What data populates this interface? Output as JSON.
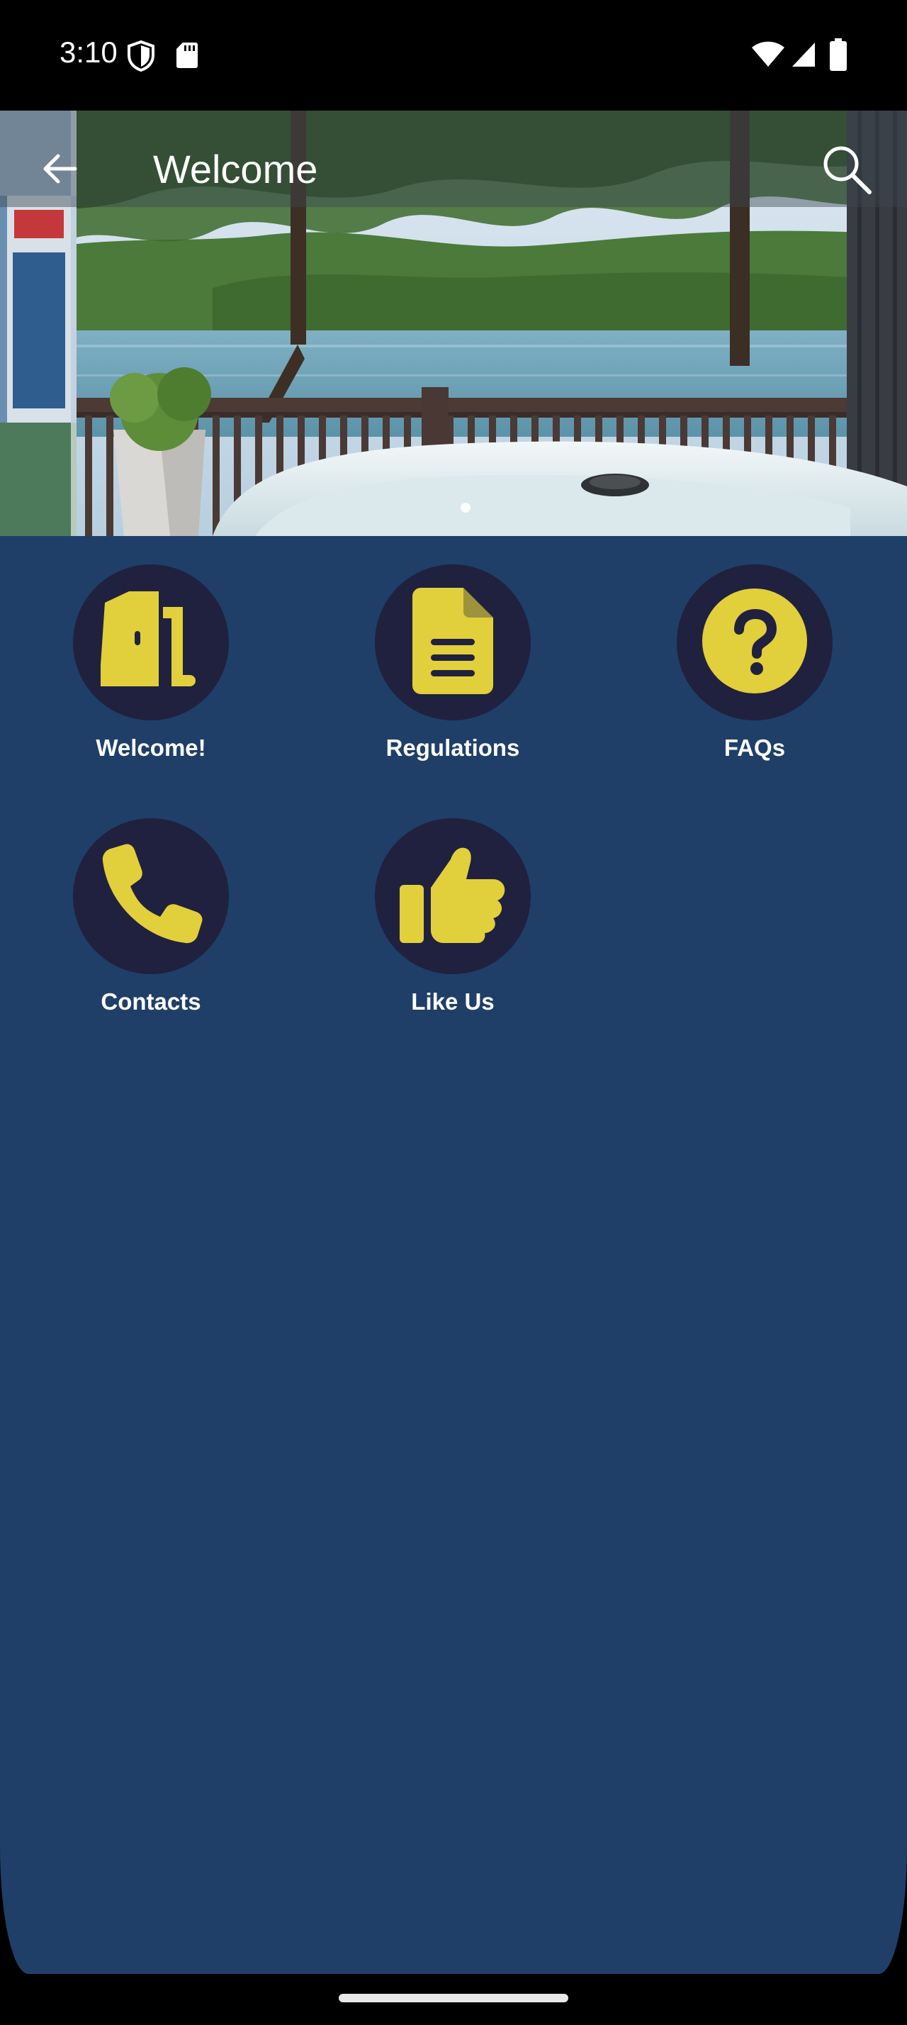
{
  "status_bar": {
    "time": "3:10",
    "icons": [
      "shield-icon",
      "sd-card-icon",
      "wifi-icon",
      "signal-icon",
      "battery-icon"
    ]
  },
  "app_bar": {
    "title": "Welcome",
    "back_icon": "arrow-back-icon",
    "search_icon": "search-icon"
  },
  "hero": {
    "carousel_pages": 1,
    "active_page": 1
  },
  "tiles": [
    {
      "label": "Welcome!",
      "icon": "door-icon"
    },
    {
      "label": "Regulations",
      "icon": "document-icon"
    },
    {
      "label": "FAQs",
      "icon": "question-icon"
    },
    {
      "label": "Contacts",
      "icon": "phone-icon"
    },
    {
      "label": "Like Us",
      "icon": "thumbs-up-icon"
    }
  ],
  "colors": {
    "background": "#1f3f68",
    "tile_circle": "#20213f",
    "icon_accent": "#e2cf3c",
    "label": "#ffffff"
  }
}
